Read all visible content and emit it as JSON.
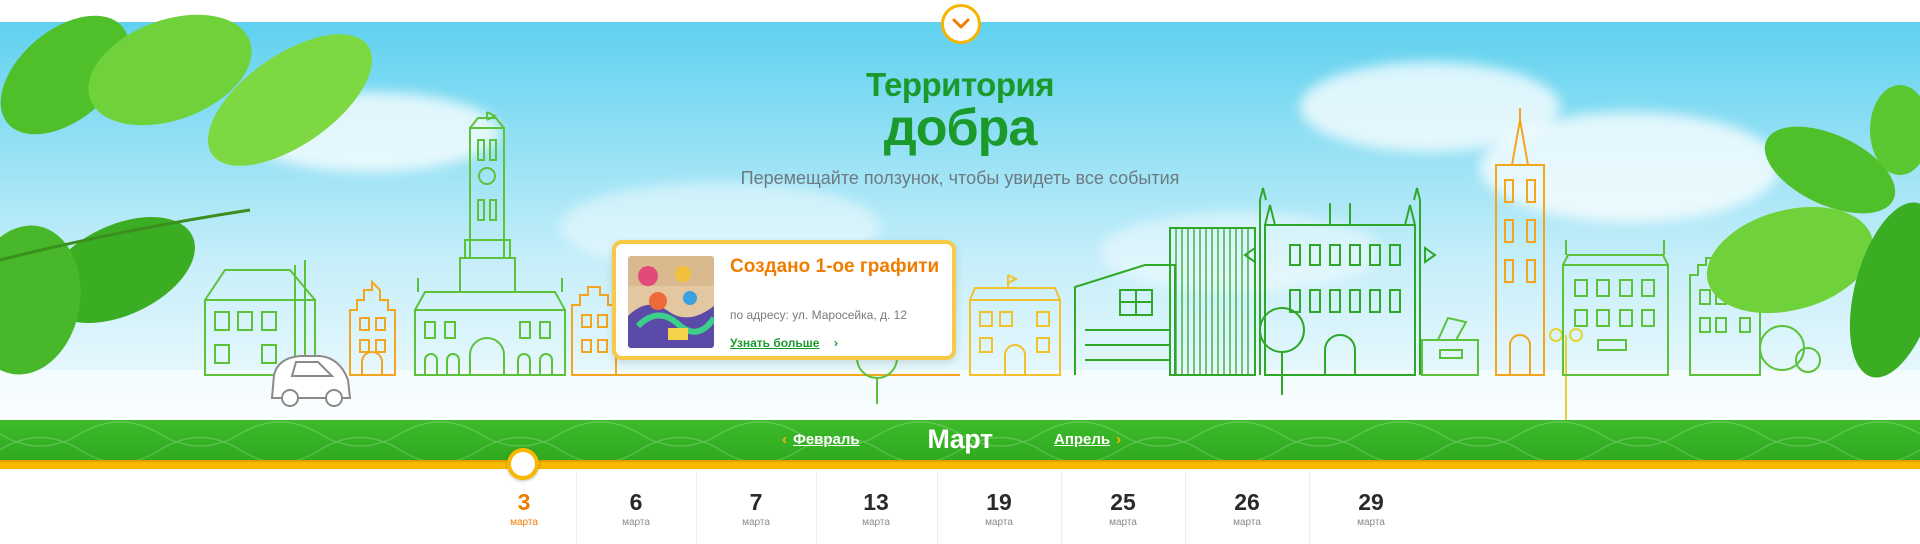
{
  "header": {
    "title_line1": "Территория",
    "title_line2": "добра",
    "subtitle": "Перемещайте ползунок, чтобы увидеть все события"
  },
  "top_toggle": {
    "icon": "chevron-down-icon"
  },
  "event": {
    "title": "Создано 1-ое графити",
    "address": "по адресу: ул. Маросейка, д. 12",
    "more_label": "Узнать больше",
    "more_arrow": "›"
  },
  "months": {
    "prev": "Февраль",
    "current": "Март",
    "next": "Апрель",
    "prev_chevron": "‹",
    "next_chevron": "›"
  },
  "dates": [
    {
      "day": "3",
      "month": "марта",
      "active": true
    },
    {
      "day": "6",
      "month": "марта",
      "active": false
    },
    {
      "day": "7",
      "month": "марта",
      "active": false
    },
    {
      "day": "13",
      "month": "марта",
      "active": false
    },
    {
      "day": "19",
      "month": "марта",
      "active": false
    },
    {
      "day": "25",
      "month": "марта",
      "active": false
    },
    {
      "day": "26",
      "month": "марта",
      "active": false
    },
    {
      "day": "29",
      "month": "марта",
      "active": false
    }
  ],
  "colors": {
    "brand_green": "#1a9a2b",
    "accent_orange": "#f07d00",
    "accent_yellow": "#f6b800",
    "sky": "#5fd1ef"
  }
}
